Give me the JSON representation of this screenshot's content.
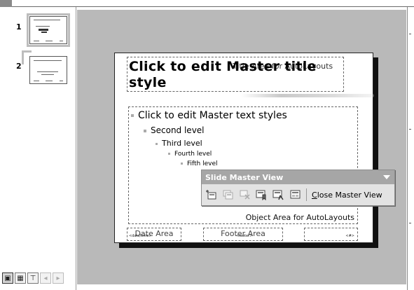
{
  "thumbnails": [
    {
      "number": "1",
      "selected": true
    },
    {
      "number": "2",
      "selected": false
    }
  ],
  "view_buttons": [
    {
      "icon": "normal-view-icon",
      "glyph": "▣"
    },
    {
      "icon": "slide-sorter-icon",
      "glyph": "▦"
    },
    {
      "icon": "slide-show-icon",
      "glyph": "⊤"
    },
    {
      "icon": "scroll-left-icon",
      "glyph": "◂"
    },
    {
      "icon": "scroll-right-icon",
      "glyph": "▸"
    }
  ],
  "slide": {
    "title": "Click to edit Master title style",
    "title_area_label": "Title Area for AutoLayouts",
    "body_levels": [
      "Click to edit Master text styles",
      "Second level",
      "Third level",
      "Fourth level",
      "Fifth level"
    ],
    "object_area_label": "Object Area for AutoLayouts",
    "date_area_label": "Date Area",
    "date_area_tag": "<date/time>",
    "footer_area_label": "Footer Area",
    "footer_area_tag": "<footer>",
    "number_area_tag": "<#>"
  },
  "toolbar": {
    "title": "Slide Master View",
    "buttons": [
      {
        "icon": "insert-new-slide-master-icon",
        "enabled": true
      },
      {
        "icon": "insert-new-title-master-icon",
        "enabled": false
      },
      {
        "icon": "delete-master-icon",
        "enabled": false
      },
      {
        "icon": "preserve-master-icon",
        "enabled": true
      },
      {
        "icon": "rename-master-icon",
        "enabled": true
      },
      {
        "icon": "master-layout-icon",
        "enabled": true
      }
    ],
    "close_label_underlined": "C",
    "close_label_rest": "lose Master View"
  }
}
